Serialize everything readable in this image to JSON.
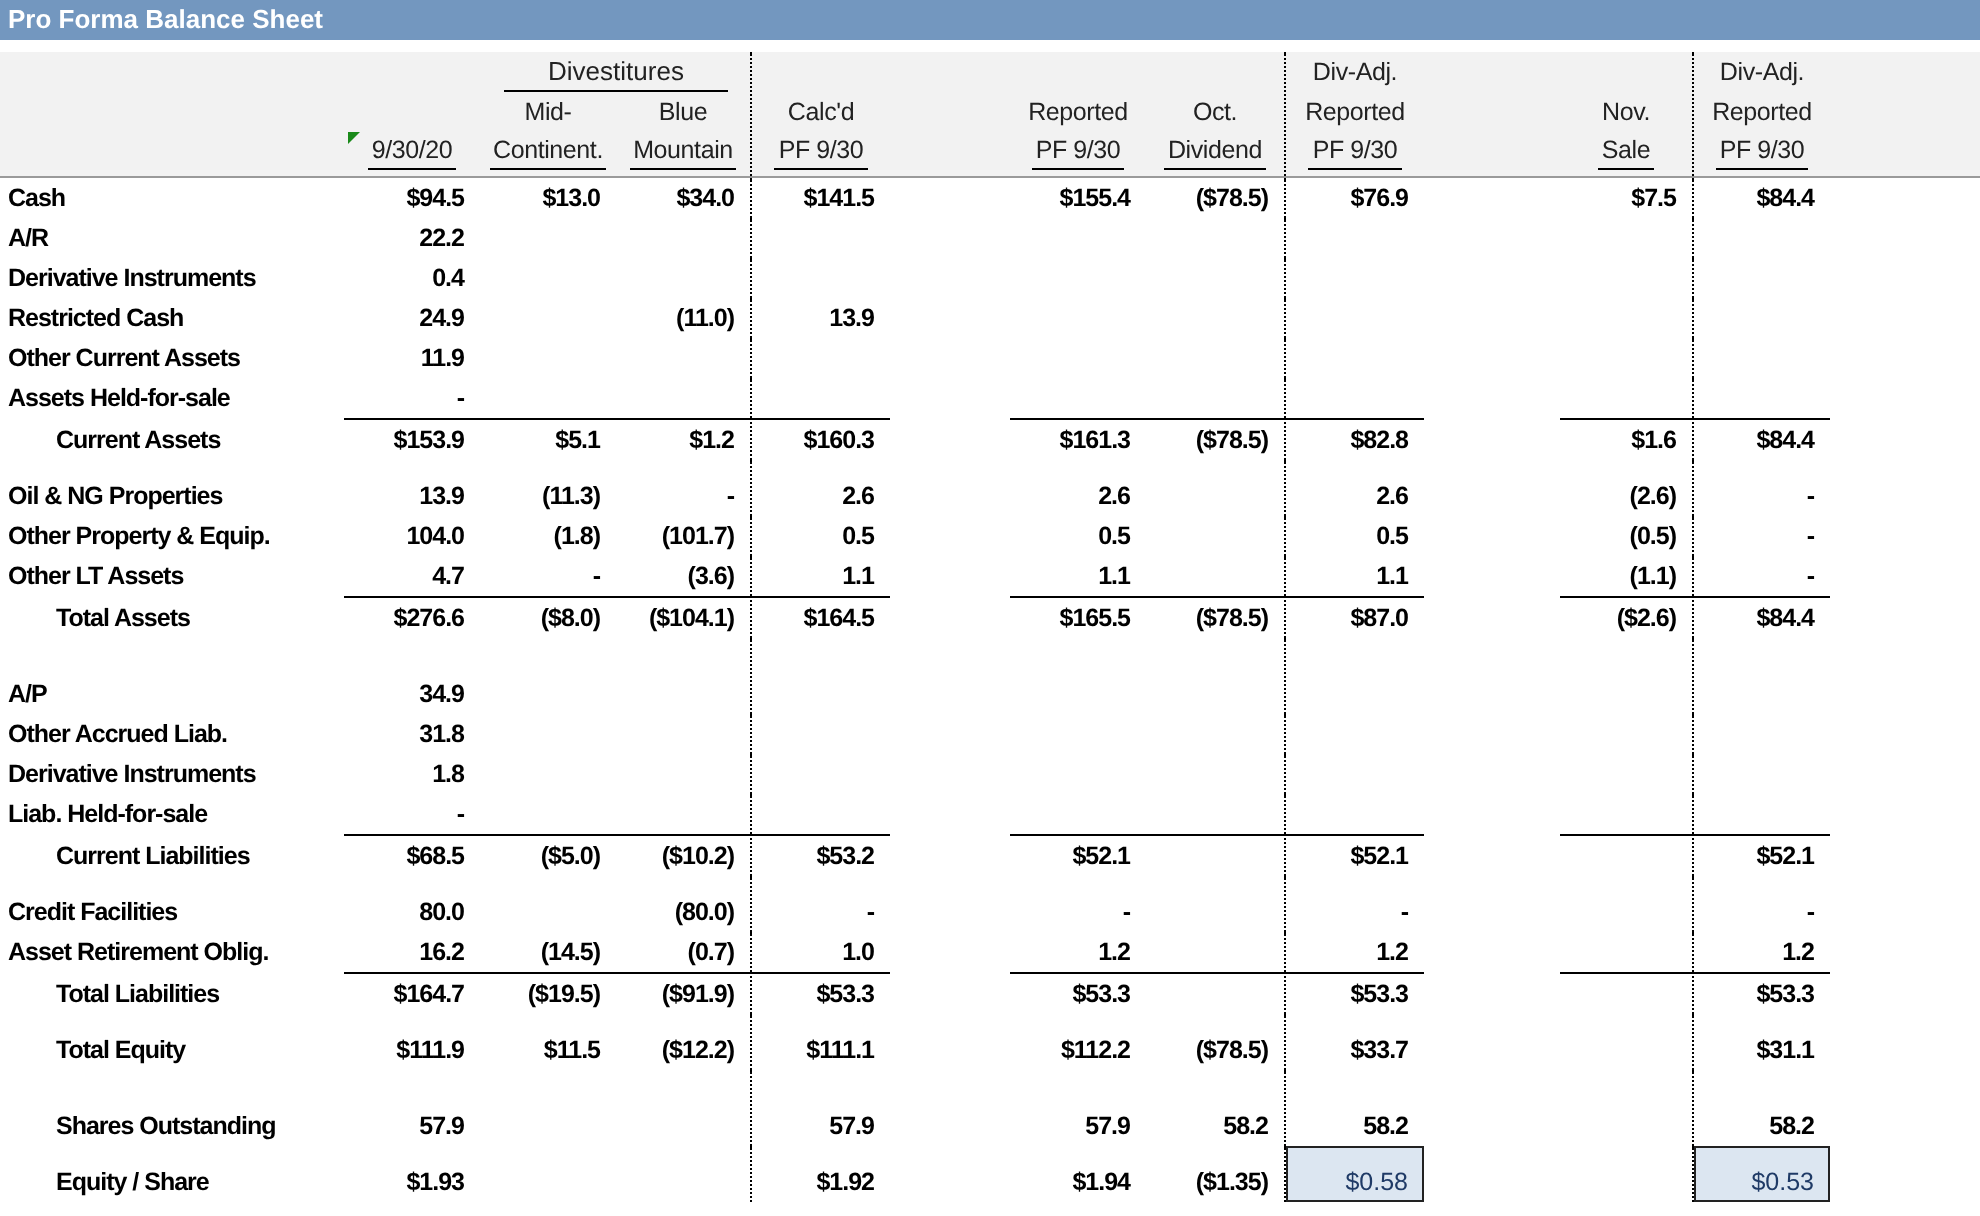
{
  "title": "Pro Forma Balance Sheet",
  "group_header": {
    "label": "Divestitures"
  },
  "columns": [
    {
      "lines": [
        "9/30/20"
      ],
      "flagged": true
    },
    {
      "lines": [
        "Mid-",
        "Continent."
      ],
      "flagged": false
    },
    {
      "lines": [
        "Blue",
        "Mountain"
      ],
      "flagged": false
    },
    {
      "lines": [
        "Calc'd",
        "PF 9/30"
      ],
      "flagged": false
    },
    {
      "lines": [
        "Reported",
        "PF 9/30"
      ],
      "flagged": false
    },
    {
      "lines": [
        "Oct.",
        "Dividend"
      ],
      "flagged": false
    },
    {
      "lines": [
        "Div-Adj.",
        "Reported",
        "PF 9/30"
      ],
      "flagged": false
    },
    {
      "lines": [
        "Nov.",
        "Sale"
      ],
      "flagged": false
    },
    {
      "lines": [
        "Div-Adj.",
        "Reported",
        "PF 9/30"
      ],
      "flagged": false
    }
  ],
  "blocks": [
    {
      "sections": [
        {
          "rows": [
            {
              "label": "Cash",
              "kind": "line",
              "cells": {
                "col_1": "$94.5",
                "col_2": "$13.0",
                "col_3": "$34.0",
                "col_4": "$141.5",
                "col_5": "$155.4",
                "col_6": "($78.5)",
                "col_7": "$76.9",
                "col_8": "$7.5",
                "col_9": "$84.4"
              }
            },
            {
              "label": "A/R",
              "kind": "line",
              "cells": {
                "col_1": "22.2"
              }
            },
            {
              "label": "Derivative Instruments",
              "kind": "line",
              "cells": {
                "col_1": "0.4"
              }
            },
            {
              "label": "Restricted Cash",
              "kind": "line",
              "cells": {
                "col_1": "24.9",
                "col_3": "(11.0)",
                "col_4": "13.9"
              }
            },
            {
              "label": "Other Current Assets",
              "kind": "line",
              "cells": {
                "col_1": "11.9"
              }
            },
            {
              "label": "Assets Held-for-sale",
              "kind": "line",
              "cells": {
                "col_1": "-"
              }
            },
            {
              "label": "Current Assets",
              "kind": "subtotal",
              "cells": {
                "col_1": "$153.9",
                "col_2": "$5.1",
                "col_3": "$1.2",
                "col_4": "$160.3",
                "col_5": "$161.3",
                "col_6": "($78.5)",
                "col_7": "$82.8",
                "col_8": "$1.6",
                "col_9": "$84.4"
              }
            }
          ]
        },
        {
          "rows": [
            {
              "label": "Oil & NG Properties",
              "kind": "line",
              "cells": {
                "col_1": "13.9",
                "col_2": "(11.3)",
                "col_3": "-",
                "col_4": "2.6",
                "col_5": "2.6",
                "col_7": "2.6",
                "col_8": "(2.6)",
                "col_9": "-"
              }
            },
            {
              "label": "Other Property & Equip.",
              "kind": "line",
              "cells": {
                "col_1": "104.0",
                "col_2": "(1.8)",
                "col_3": "(101.7)",
                "col_4": "0.5",
                "col_5": "0.5",
                "col_7": "0.5",
                "col_8": "(0.5)",
                "col_9": "-"
              }
            },
            {
              "label": "Other LT Assets",
              "kind": "line",
              "cells": {
                "col_1": "4.7",
                "col_2": "-",
                "col_3": "(3.6)",
                "col_4": "1.1",
                "col_5": "1.1",
                "col_7": "1.1",
                "col_8": "(1.1)",
                "col_9": "-"
              }
            },
            {
              "label": "Total Assets",
              "kind": "subtotal",
              "cells": {
                "col_1": "$276.6",
                "col_2": "($8.0)",
                "col_3": "($104.1)",
                "col_4": "$164.5",
                "col_5": "$165.5",
                "col_6": "($78.5)",
                "col_7": "$87.0",
                "col_8": "($2.6)",
                "col_9": "$84.4"
              }
            }
          ]
        }
      ]
    },
    {
      "sections": [
        {
          "rows": [
            {
              "label": "A/P",
              "kind": "line",
              "cells": {
                "col_1": "34.9"
              }
            },
            {
              "label": "Other Accrued Liab.",
              "kind": "line",
              "cells": {
                "col_1": "31.8"
              }
            },
            {
              "label": "Derivative Instruments",
              "kind": "line",
              "cells": {
                "col_1": "1.8"
              }
            },
            {
              "label": "Liab. Held-for-sale",
              "kind": "line",
              "cells": {
                "col_1": "-"
              }
            },
            {
              "label": "Current Liabilities",
              "kind": "subtotal",
              "cells": {
                "col_1": "$68.5",
                "col_2": "($5.0)",
                "col_3": "($10.2)",
                "col_4": "$53.2",
                "col_5": "$52.1",
                "col_7": "$52.1",
                "col_9": "$52.1"
              }
            }
          ]
        },
        {
          "rows": [
            {
              "label": "Credit Facilities",
              "kind": "line",
              "cells": {
                "col_1": "80.0",
                "col_3": "(80.0)",
                "col_4": "-",
                "col_5": "-",
                "col_7": "-",
                "col_9": "-"
              }
            },
            {
              "label": "Asset Retirement Oblig.",
              "kind": "line",
              "cells": {
                "col_1": "16.2",
                "col_2": "(14.5)",
                "col_3": "(0.7)",
                "col_4": "1.0",
                "col_5": "1.2",
                "col_7": "1.2",
                "col_9": "1.2"
              }
            },
            {
              "label": "Total Liabilities",
              "kind": "subtotal",
              "cells": {
                "col_1": "$164.7",
                "col_2": "($19.5)",
                "col_3": "($91.9)",
                "col_4": "$53.3",
                "col_5": "$53.3",
                "col_7": "$53.3",
                "col_9": "$53.3"
              }
            }
          ]
        },
        {
          "rows": [
            {
              "label": "Total Equity",
              "kind": "total",
              "cells": {
                "col_1": "$111.9",
                "col_2": "$11.5",
                "col_3": "($12.2)",
                "col_4": "$111.1",
                "col_5": "$112.2",
                "col_6": "($78.5)",
                "col_7": "$33.7",
                "col_9": "$31.1"
              }
            }
          ]
        }
      ]
    },
    {
      "sections": [
        {
          "rows": [
            {
              "label": "Shares Outstanding",
              "kind": "total",
              "cells": {
                "col_1": "57.9",
                "col_4": "57.9",
                "col_5": "57.9",
                "col_6": "58.2",
                "col_7": "58.2",
                "col_9": "58.2"
              }
            }
          ]
        },
        {
          "rows": [
            {
              "label": "Equity / Share",
              "kind": "total",
              "cells": {
                "col_1": "$1.93",
                "col_4": "$1.92",
                "col_5": "$1.94",
                "col_6": "($1.35)",
                "col_7": {
                  "text": "$0.58",
                  "highlighted": true
                },
                "col_9": {
                  "text": "$0.53",
                  "highlighted": true
                }
              }
            }
          ]
        }
      ]
    }
  ]
}
